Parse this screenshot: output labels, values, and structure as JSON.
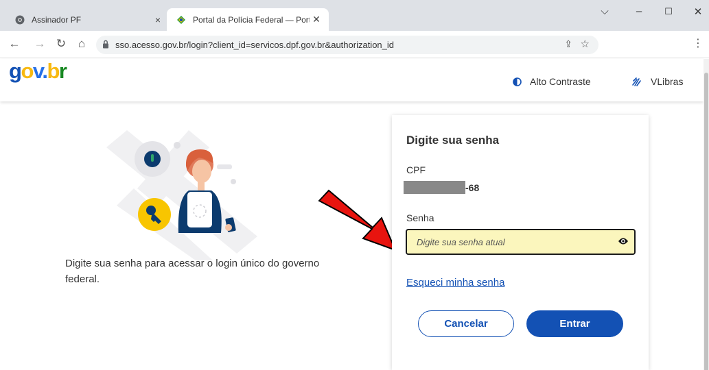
{
  "browser": {
    "tabs": [
      {
        "label": "Assinador PF",
        "close": "×"
      },
      {
        "label": "Portal da Polícia Federal — Portu",
        "close": "✕"
      }
    ],
    "window_controls": {
      "dropdown": "⌵",
      "minimize": "–",
      "maximize": "☐",
      "close": "✕"
    },
    "nav": {
      "back": "←",
      "forward": "→",
      "reload": "↻",
      "home": "⌂"
    },
    "url": "sso.acesso.gov.br/login?client_id=servicos.dpf.gov.br&authorization_id",
    "share_glyph": "⇪",
    "star_glyph": "☆",
    "menu_glyph": "⋮"
  },
  "header": {
    "logo": {
      "g": "g",
      "o": "o",
      "v": "v",
      "dot": ".",
      "b": "b",
      "r": "r"
    },
    "contrast_label": "Alto Contraste",
    "vlibras_label": "VLibras"
  },
  "main": {
    "description": "Digite sua senha para acessar o login único do governo federal."
  },
  "card": {
    "title": "Digite sua senha",
    "cpf_label": "CPF",
    "cpf_suffix": "-68",
    "password_label": "Senha",
    "password_placeholder": "Digite sua senha atual",
    "forgot_link": "Esqueci minha senha",
    "cancel_label": "Cancelar",
    "submit_label": "Entrar"
  },
  "colors": {
    "primary": "#1351b4",
    "input_highlight": "#fbf6bd",
    "arrow": "#e8140f"
  }
}
